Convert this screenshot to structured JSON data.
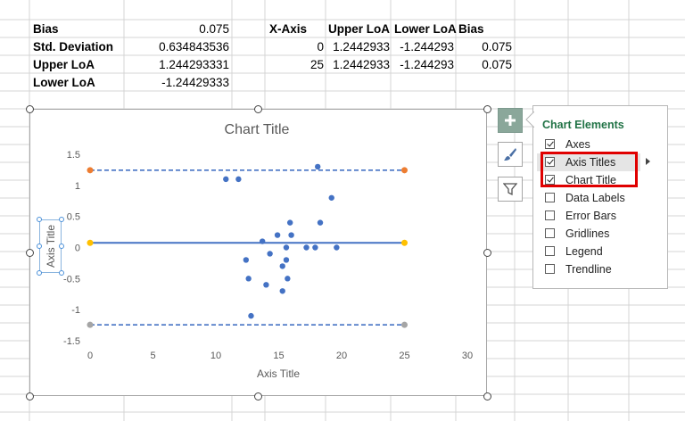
{
  "table1": [
    {
      "label": "Bias",
      "value": "0.075"
    },
    {
      "label": "Std. Deviation",
      "value": "0.634843536"
    },
    {
      "label": "Upper LoA",
      "value": "1.244293331"
    },
    {
      "label": "Lower LoA",
      "value": "-1.24429333"
    }
  ],
  "table2": {
    "headers": [
      "X-Axis",
      "Upper LoA",
      "Lower LoA",
      "Bias"
    ],
    "rows": [
      [
        "0",
        "1.2442933",
        "-1.244293",
        "0.075"
      ],
      [
        "25",
        "1.2442933",
        "-1.244293",
        "0.075"
      ]
    ]
  },
  "chart_data": {
    "type": "scatter",
    "title": "Chart Title",
    "xlabel": "Axis Title",
    "ylabel": "Axis Title",
    "xlim": [
      0,
      30
    ],
    "ylim": [
      -1.5,
      1.5
    ],
    "xticks": [
      0,
      5,
      10,
      15,
      20,
      25,
      30
    ],
    "yticks": [
      -1.5,
      -1,
      -0.5,
      0,
      0.5,
      1,
      1.5
    ],
    "xtick_labels": [
      "0",
      "5",
      "10",
      "15",
      "20",
      "25",
      "30"
    ],
    "ytick_labels": [
      "-1.5",
      "-1",
      "-0.5",
      "0",
      "0.5",
      "1",
      "1.5"
    ],
    "grid": false,
    "points": [
      [
        10.8,
        1.1
      ],
      [
        11.8,
        1.1
      ],
      [
        12.4,
        -0.2
      ],
      [
        12.6,
        -0.5
      ],
      [
        12.8,
        -1.1
      ],
      [
        13.7,
        0.1
      ],
      [
        14.0,
        -0.6
      ],
      [
        14.3,
        -0.1
      ],
      [
        14.9,
        0.2
      ],
      [
        15.3,
        -0.3
      ],
      [
        15.3,
        -0.7
      ],
      [
        15.6,
        -0.2
      ],
      [
        15.6,
        0.0
      ],
      [
        15.7,
        -0.5
      ],
      [
        15.9,
        0.4
      ],
      [
        16.0,
        0.2
      ],
      [
        17.2,
        0.0
      ],
      [
        17.9,
        0.0
      ],
      [
        18.1,
        1.3
      ],
      [
        18.3,
        0.4
      ],
      [
        19.2,
        0.8
      ],
      [
        19.6,
        0.0
      ]
    ],
    "point_color": "#4472c4",
    "lines": [
      {
        "x": [
          0,
          25
        ],
        "y": [
          1.2442933,
          1.2442933
        ],
        "style": "dashed",
        "color": "#4472c4",
        "marker_color": "#ed7d31"
      },
      {
        "x": [
          0,
          25
        ],
        "y": [
          0.075,
          0.075
        ],
        "style": "solid",
        "color": "#4472c4",
        "marker_color": "#ffc000"
      },
      {
        "x": [
          0,
          25
        ],
        "y": [
          -1.244293,
          -1.244293
        ],
        "style": "dashed",
        "color": "#4472c4",
        "marker_color": "#a5a5a5"
      }
    ]
  },
  "panel": {
    "title": "Chart Elements",
    "options": [
      {
        "label": "Axes",
        "checked": true
      },
      {
        "label": "Axis Titles",
        "checked": true
      },
      {
        "label": "Chart Title",
        "checked": true
      },
      {
        "label": "Data Labels",
        "checked": false
      },
      {
        "label": "Error Bars",
        "checked": false
      },
      {
        "label": "Gridlines",
        "checked": false
      },
      {
        "label": "Legend",
        "checked": false
      },
      {
        "label": "Trendline",
        "checked": false
      }
    ]
  },
  "icons": {
    "plus": "plus-icon",
    "brush": "paintbrush-icon",
    "filter": "filter-icon"
  },
  "colors": {
    "accent_green": "#217346",
    "series_blue": "#4472c4",
    "highlight_red": "#e00000"
  }
}
